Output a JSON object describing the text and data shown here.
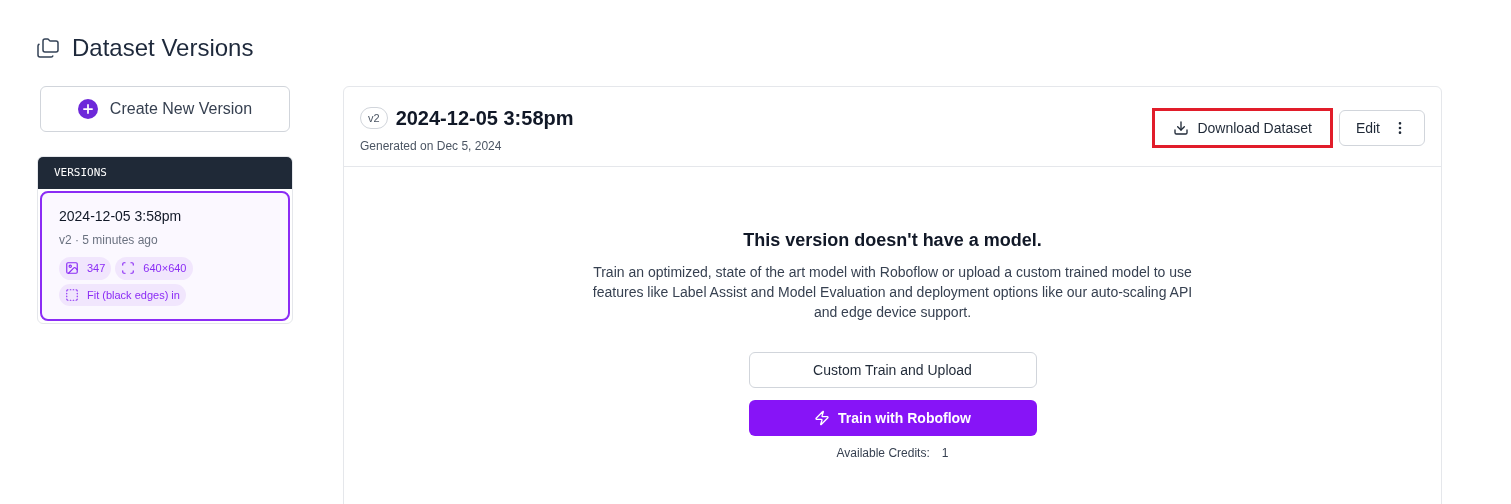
{
  "page_title": "Dataset Versions",
  "create_button": "Create New Version",
  "versions_panel": {
    "title": "VERSIONS",
    "items": [
      {
        "name": "2024-12-05 3:58pm",
        "meta": "v2 · 5 minutes ago",
        "selected": true,
        "tags": [
          {
            "kind": "images",
            "label": "347"
          },
          {
            "kind": "size",
            "label": "640×640"
          },
          {
            "kind": "fit",
            "label": "Fit (black edges) in"
          }
        ]
      }
    ]
  },
  "detail": {
    "version_badge": "v2",
    "title": "2024-12-05 3:58pm",
    "subtitle": "Generated on Dec 5, 2024",
    "download_button": {
      "label": "Download Dataset",
      "highlighted": true
    },
    "edit_button": "Edit",
    "empty_title": "This version doesn't have a model.",
    "empty_text": "Train an optimized, state of the art model with Roboflow or upload a custom trained model to use features like Label Assist and Model Evaluation and deployment options like our auto-scaling API and edge device support.",
    "custom_button": "Custom Train and Upload",
    "train_button": "Train with Roboflow",
    "credits_label": "Available Credits:",
    "credits_value": "1"
  }
}
